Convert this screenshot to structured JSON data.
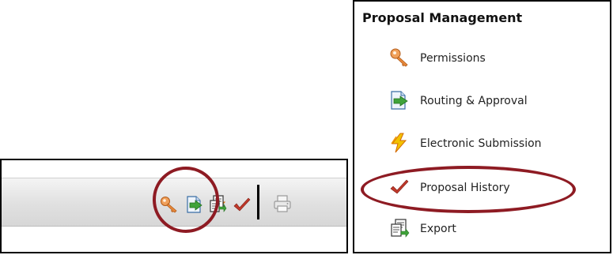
{
  "menu": {
    "title": "Proposal Management",
    "items": [
      {
        "label": "Permissions",
        "icon": "key-icon"
      },
      {
        "label": "Routing & Approval",
        "icon": "routing-approval-icon"
      },
      {
        "label": "Electronic Submission",
        "icon": "lightning-icon"
      },
      {
        "label": "Proposal History",
        "icon": "checkmark-icon",
        "highlighted": true
      },
      {
        "label": "Export",
        "icon": "export-icon"
      }
    ]
  },
  "toolbar": {
    "icons": [
      "key-icon",
      "routing-approval-icon",
      "lightning-icon",
      "checkmark-icon",
      "export-icon",
      "print-icon"
    ],
    "highlighted_icon": "checkmark-icon"
  },
  "colors": {
    "highlight_ring": "#8e1b23",
    "checkmark": "#c0392b",
    "key": "#e8893a",
    "lightning": "#f2c200",
    "routing_arrow": "#3fa33a"
  }
}
